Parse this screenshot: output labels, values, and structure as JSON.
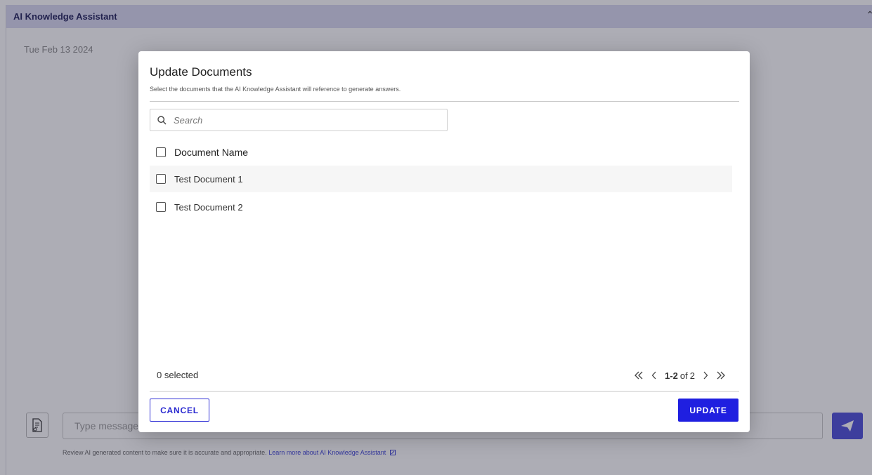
{
  "app": {
    "title": "AI Knowledge Assistant",
    "date": "Tue Feb 13 2024",
    "message_placeholder": "Type message",
    "disclaimer_text": "Review AI generated content to make sure it is accurate and appropriate.",
    "learn_more_link": "Learn more about AI Knowledge Assistant"
  },
  "modal": {
    "title": "Update Documents",
    "subtitle": "Select the documents that the AI Knowledge Assistant will reference to generate answers.",
    "search_placeholder": "Search",
    "column_header": "Document Name",
    "documents": [
      {
        "name": "Test Document 1",
        "checked": false
      },
      {
        "name": "Test Document 2",
        "checked": false
      }
    ],
    "selected_count": "0 selected",
    "pagination": {
      "range": "1-2",
      "of": "of",
      "total": "2"
    },
    "cancel_label": "CANCEL",
    "update_label": "UPDATE"
  },
  "colors": {
    "header_bg": "#d9d9f0",
    "primary": "#1f1fe0",
    "send_button": "#4b4dd9"
  }
}
